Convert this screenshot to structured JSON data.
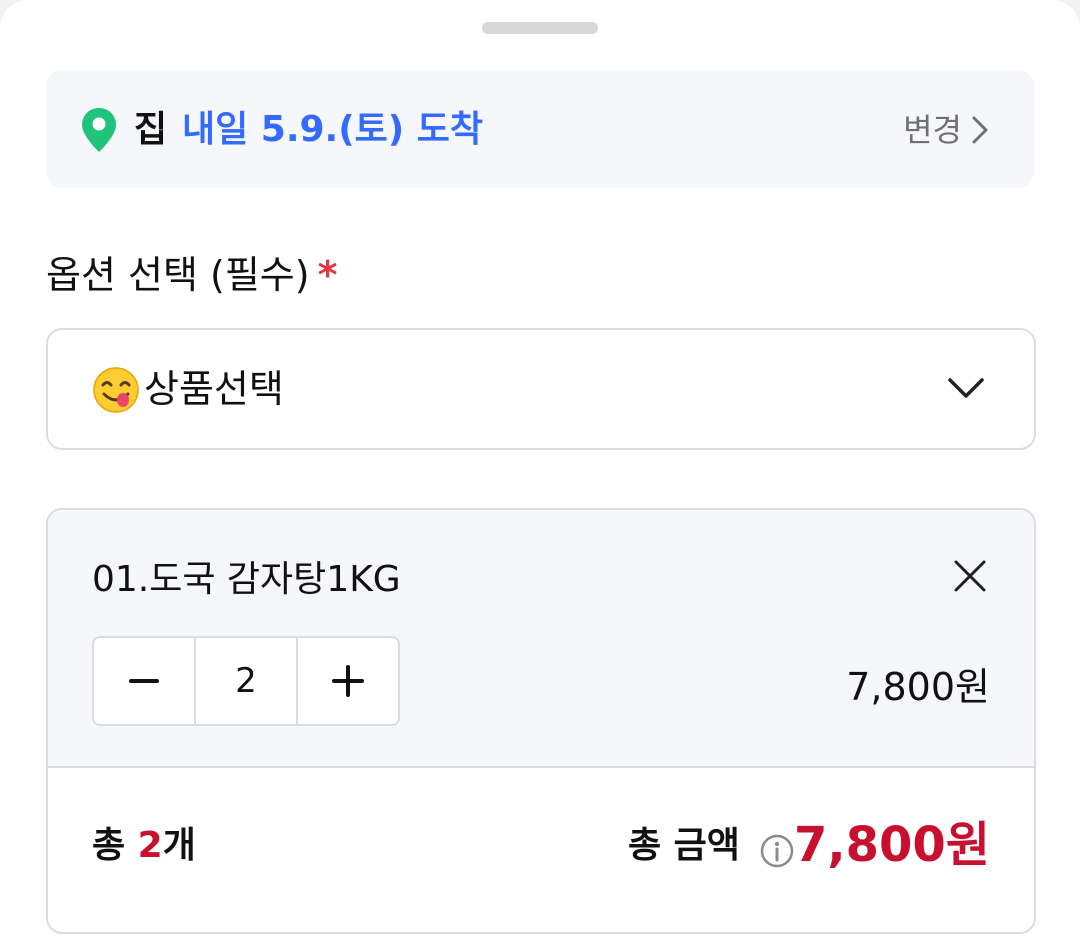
{
  "delivery": {
    "place": "집",
    "date_text": "내일 5.9.(토) 도착",
    "change_label": "변경",
    "place_color": "#111111",
    "date_color": "#346aff",
    "pin_icon": "location-pin-icon",
    "pin_color": "#1fc37a"
  },
  "option": {
    "label": "옵션 선택 (필수)",
    "required_mark": "*",
    "select_text": "상품선택",
    "select_emoji": "savoring-face-emoji"
  },
  "item": {
    "name": "01.도국 감자탕1KG",
    "quantity": "2",
    "minus_label": "−",
    "plus_label": "+",
    "price": "7,800원"
  },
  "summary": {
    "total_prefix": "총 ",
    "total_count": "2",
    "total_suffix": "개",
    "amount_label": "총 금액",
    "amount": "7,800원",
    "accent_color": "#c8102e"
  }
}
